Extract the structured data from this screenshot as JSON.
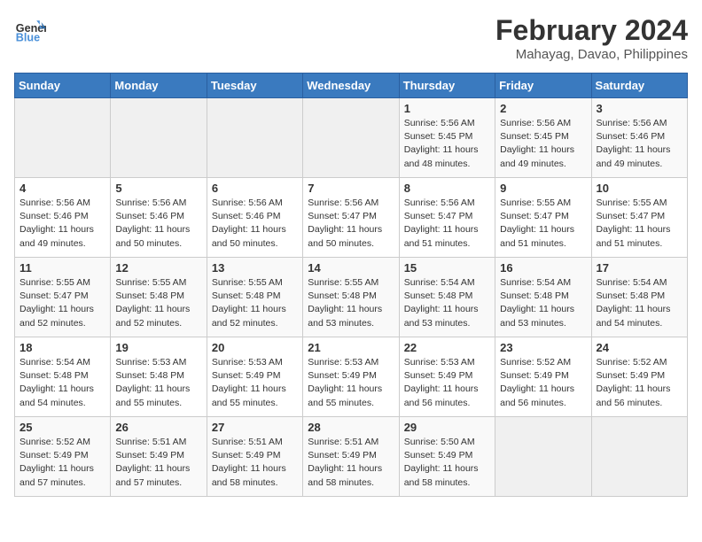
{
  "logo": {
    "text_general": "General",
    "text_blue": "Blue"
  },
  "title": "February 2024",
  "subtitle": "Mahayag, Davao, Philippines",
  "weekdays": [
    "Sunday",
    "Monday",
    "Tuesday",
    "Wednesday",
    "Thursday",
    "Friday",
    "Saturday"
  ],
  "weeks": [
    [
      {
        "day": "",
        "info": ""
      },
      {
        "day": "",
        "info": ""
      },
      {
        "day": "",
        "info": ""
      },
      {
        "day": "",
        "info": ""
      },
      {
        "day": "1",
        "info": "Sunrise: 5:56 AM\nSunset: 5:45 PM\nDaylight: 11 hours\nand 48 minutes."
      },
      {
        "day": "2",
        "info": "Sunrise: 5:56 AM\nSunset: 5:45 PM\nDaylight: 11 hours\nand 49 minutes."
      },
      {
        "day": "3",
        "info": "Sunrise: 5:56 AM\nSunset: 5:46 PM\nDaylight: 11 hours\nand 49 minutes."
      }
    ],
    [
      {
        "day": "4",
        "info": "Sunrise: 5:56 AM\nSunset: 5:46 PM\nDaylight: 11 hours\nand 49 minutes."
      },
      {
        "day": "5",
        "info": "Sunrise: 5:56 AM\nSunset: 5:46 PM\nDaylight: 11 hours\nand 50 minutes."
      },
      {
        "day": "6",
        "info": "Sunrise: 5:56 AM\nSunset: 5:46 PM\nDaylight: 11 hours\nand 50 minutes."
      },
      {
        "day": "7",
        "info": "Sunrise: 5:56 AM\nSunset: 5:47 PM\nDaylight: 11 hours\nand 50 minutes."
      },
      {
        "day": "8",
        "info": "Sunrise: 5:56 AM\nSunset: 5:47 PM\nDaylight: 11 hours\nand 51 minutes."
      },
      {
        "day": "9",
        "info": "Sunrise: 5:55 AM\nSunset: 5:47 PM\nDaylight: 11 hours\nand 51 minutes."
      },
      {
        "day": "10",
        "info": "Sunrise: 5:55 AM\nSunset: 5:47 PM\nDaylight: 11 hours\nand 51 minutes."
      }
    ],
    [
      {
        "day": "11",
        "info": "Sunrise: 5:55 AM\nSunset: 5:47 PM\nDaylight: 11 hours\nand 52 minutes."
      },
      {
        "day": "12",
        "info": "Sunrise: 5:55 AM\nSunset: 5:48 PM\nDaylight: 11 hours\nand 52 minutes."
      },
      {
        "day": "13",
        "info": "Sunrise: 5:55 AM\nSunset: 5:48 PM\nDaylight: 11 hours\nand 52 minutes."
      },
      {
        "day": "14",
        "info": "Sunrise: 5:55 AM\nSunset: 5:48 PM\nDaylight: 11 hours\nand 53 minutes."
      },
      {
        "day": "15",
        "info": "Sunrise: 5:54 AM\nSunset: 5:48 PM\nDaylight: 11 hours\nand 53 minutes."
      },
      {
        "day": "16",
        "info": "Sunrise: 5:54 AM\nSunset: 5:48 PM\nDaylight: 11 hours\nand 53 minutes."
      },
      {
        "day": "17",
        "info": "Sunrise: 5:54 AM\nSunset: 5:48 PM\nDaylight: 11 hours\nand 54 minutes."
      }
    ],
    [
      {
        "day": "18",
        "info": "Sunrise: 5:54 AM\nSunset: 5:48 PM\nDaylight: 11 hours\nand 54 minutes."
      },
      {
        "day": "19",
        "info": "Sunrise: 5:53 AM\nSunset: 5:48 PM\nDaylight: 11 hours\nand 55 minutes."
      },
      {
        "day": "20",
        "info": "Sunrise: 5:53 AM\nSunset: 5:49 PM\nDaylight: 11 hours\nand 55 minutes."
      },
      {
        "day": "21",
        "info": "Sunrise: 5:53 AM\nSunset: 5:49 PM\nDaylight: 11 hours\nand 55 minutes."
      },
      {
        "day": "22",
        "info": "Sunrise: 5:53 AM\nSunset: 5:49 PM\nDaylight: 11 hours\nand 56 minutes."
      },
      {
        "day": "23",
        "info": "Sunrise: 5:52 AM\nSunset: 5:49 PM\nDaylight: 11 hours\nand 56 minutes."
      },
      {
        "day": "24",
        "info": "Sunrise: 5:52 AM\nSunset: 5:49 PM\nDaylight: 11 hours\nand 56 minutes."
      }
    ],
    [
      {
        "day": "25",
        "info": "Sunrise: 5:52 AM\nSunset: 5:49 PM\nDaylight: 11 hours\nand 57 minutes."
      },
      {
        "day": "26",
        "info": "Sunrise: 5:51 AM\nSunset: 5:49 PM\nDaylight: 11 hours\nand 57 minutes."
      },
      {
        "day": "27",
        "info": "Sunrise: 5:51 AM\nSunset: 5:49 PM\nDaylight: 11 hours\nand 58 minutes."
      },
      {
        "day": "28",
        "info": "Sunrise: 5:51 AM\nSunset: 5:49 PM\nDaylight: 11 hours\nand 58 minutes."
      },
      {
        "day": "29",
        "info": "Sunrise: 5:50 AM\nSunset: 5:49 PM\nDaylight: 11 hours\nand 58 minutes."
      },
      {
        "day": "",
        "info": ""
      },
      {
        "day": "",
        "info": ""
      }
    ]
  ]
}
